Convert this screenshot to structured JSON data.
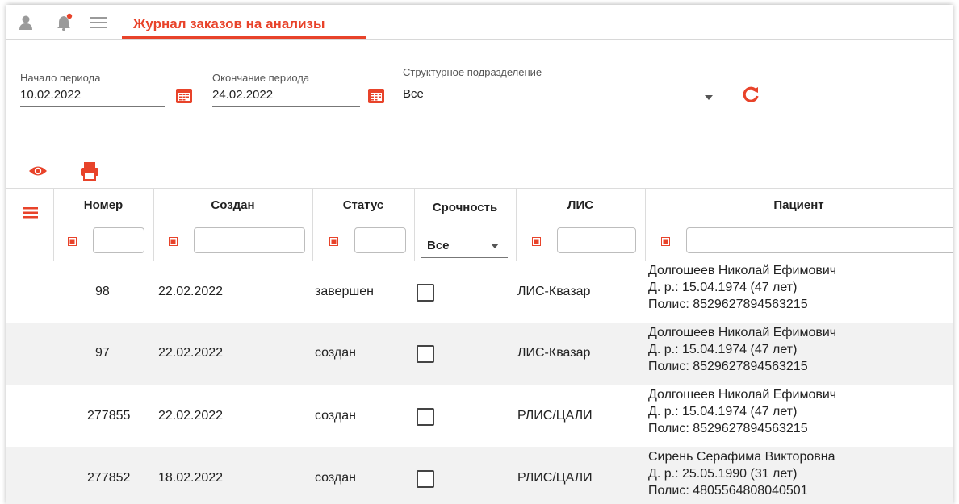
{
  "header": {
    "title": "Журнал заказов на анализы",
    "icons": [
      "user-icon",
      "bell-icon",
      "menu-icon"
    ],
    "accent_color": "#e8432a"
  },
  "filters": {
    "start_label": "Начало периода",
    "start_value": "10.02.2022",
    "end_label": "Окончание периода",
    "end_value": "24.02.2022",
    "dept_label": "Структурное подразделение",
    "dept_value": "Все"
  },
  "toolbar": {
    "icons": [
      "eye-icon",
      "print-icon",
      "refresh-icon"
    ]
  },
  "table": {
    "columns": {
      "number": "Номер",
      "created": "Создан",
      "status": "Статус",
      "urgency": "Срочность",
      "lis": "ЛИС",
      "patient": "Пациент"
    },
    "urgency_filter_value": "Все",
    "rows": [
      {
        "number": "98",
        "created": "22.02.2022",
        "status": "завершен",
        "lis": "ЛИС-Квазар",
        "patient_name": "Долгошеев Николай Ефимович",
        "patient_dob": "Д. р.: 15.04.1974 (47 лет)",
        "patient_policy": "Полис: 8529627894563215"
      },
      {
        "number": "97",
        "created": "22.02.2022",
        "status": "создан",
        "lis": "ЛИС-Квазар",
        "patient_name": "Долгошеев Николай Ефимович",
        "patient_dob": "Д. р.: 15.04.1974 (47 лет)",
        "patient_policy": "Полис: 8529627894563215"
      },
      {
        "number": "277855",
        "created": "22.02.2022",
        "status": "создан",
        "lis": "РЛИС/ЦАЛИ",
        "patient_name": "Долгошеев Николай Ефимович",
        "patient_dob": "Д. р.: 15.04.1974 (47 лет)",
        "patient_policy": "Полис: 8529627894563215"
      },
      {
        "number": "277852",
        "created": "18.02.2022",
        "status": "создан",
        "lis": "РЛИС/ЦАЛИ",
        "patient_name": "Сирень Серафима Викторовна",
        "patient_dob": "Д. р.: 25.05.1990 (31 лет)",
        "patient_policy": "Полис: 4805564808040501"
      }
    ]
  }
}
